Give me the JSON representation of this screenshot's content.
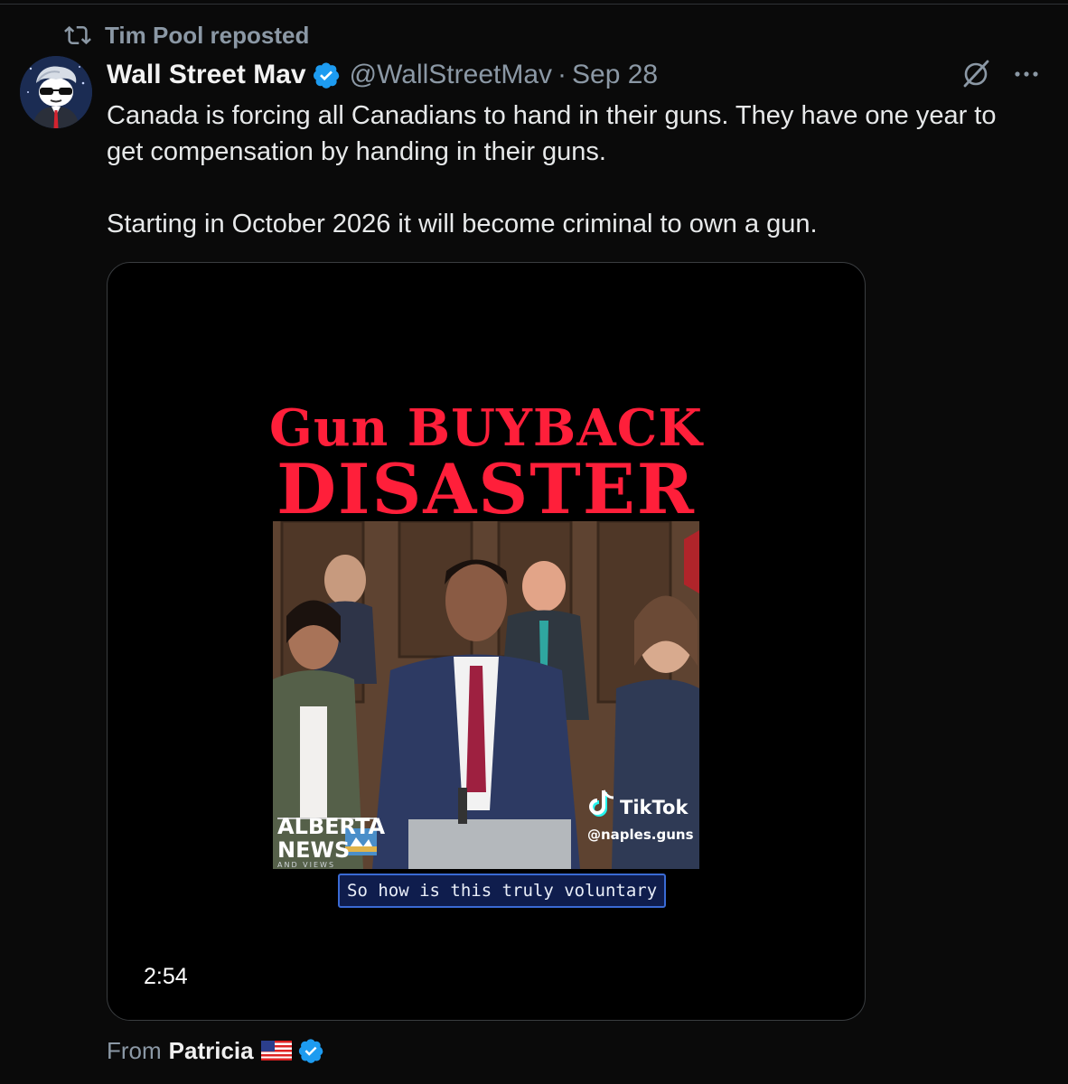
{
  "repost": {
    "icon": "repost-icon",
    "text": "Tim Pool reposted"
  },
  "post": {
    "author_name": "Wall Street Mav",
    "handle": "@WallStreetMav",
    "separator": "·",
    "date": "Sep 28",
    "text_lines": [
      "Canada is forcing all Canadians to hand in their guns. They have one year to",
      "get compensation by handing in their guns.",
      "Starting in October 2026 it will become criminal to own a gun."
    ]
  },
  "video": {
    "title_line1": "Gun BUYBACK",
    "title_line2": "DISASTER",
    "tiktok_label": "TikTok",
    "tiktok_handle": "@naples.guns",
    "logo_line1": "ALBERTA",
    "logo_line2": "NEWS",
    "logo_line3": "AND VIEWS",
    "caption": "So how is this truly voluntary",
    "duration": "2:54"
  },
  "source": {
    "prefix": "From",
    "name": "Patricia"
  },
  "colors": {
    "background": "#0a0a0a",
    "title_red": "#ff1f3a",
    "verified_blue": "#1d9bf0",
    "muted": "#8b98a5"
  }
}
